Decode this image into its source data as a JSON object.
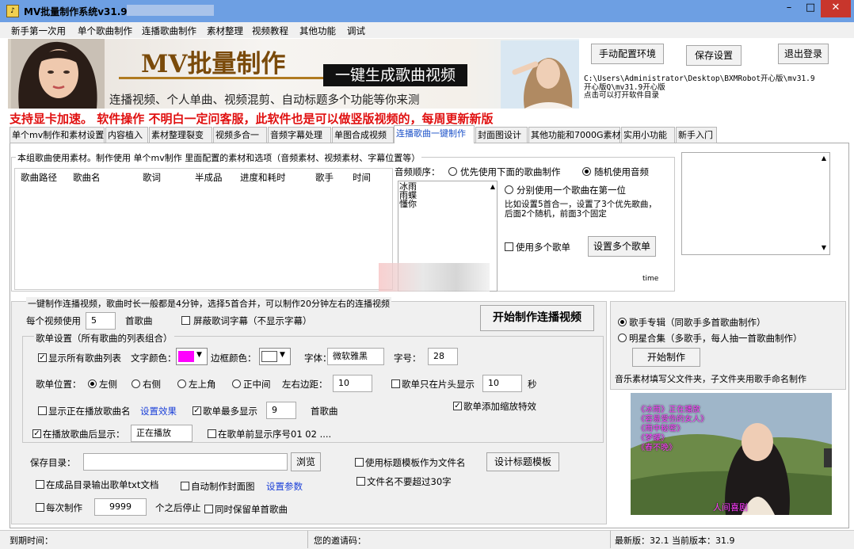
{
  "window": {
    "title": "MV批量制作系统v31.9",
    "minimize": "–",
    "maximize": "□",
    "close": "✕"
  },
  "menu": [
    "新手第一次用",
    "单个歌曲制作",
    "连播歌曲制作",
    "素材整理",
    "视频教程",
    "其他功能",
    "调试"
  ],
  "banner": {
    "big_title": "MV批量制作",
    "tagline": "一键生成歌曲视频",
    "subtitle": "连播视频、个人单曲、视频混剪、自动标题多个功能等你来测"
  },
  "top_buttons": {
    "configure": "手动配置环境",
    "save": "保存设置",
    "logout": "退出登录"
  },
  "path_info": "C:\\Users\\Administrator\\Desktop\\BXMRobot开心版\\mv31.9\n开心版Q\\mv31.9开心版\n点击可以打开软件目录",
  "notice": "支持显卡加速。 软件操作 不明白一定问客服，此软件也是可以做竖版视频的，每周更新新版",
  "tabs": [
    "单个mv制作和素材设置",
    "内容植入",
    "素材整理裂变",
    "视频多合一",
    "音频字幕处理",
    "单图合成视频",
    "连播歌曲一键制作",
    "封面图设计",
    "其他功能和7000G素材",
    "实用小功能",
    "新手入门"
  ],
  "active_tab": "连播歌曲一键制作",
  "song_group": {
    "title": "本组歌曲使用素材。制作使用 单个mv制作 里面配置的素材和选项（音频素材、视频素材、字幕位置等）",
    "columns": [
      "歌曲路径",
      "歌曲名",
      "歌词",
      "半成品",
      "进度和耗时",
      "歌手",
      "时间"
    ]
  },
  "audio_order": {
    "label": "音频顺序：",
    "opt_first": "优先使用下面的歌曲制作",
    "opt_random": "随机使用音频",
    "songs": [
      "冰雨",
      "雨蝶",
      "懂你"
    ],
    "opt_each": "分别使用一个歌曲在第一位",
    "explain": "比如设置5首合一，设置了3个优先歌曲，后面2个随机，前面3个固定",
    "multi_list": "使用多个歌单",
    "set_multi": "设置多个歌单",
    "time_label": "time"
  },
  "main": {
    "group_title": "一键制作连播视频，歌曲时长一般都是4分钟，选择5首合并，可以制作20分钟左右的连播视频",
    "per_video_label": "每个视频使用",
    "per_video_value": "5",
    "per_video_unit": "首歌曲",
    "hide_lyrics": "屏蔽歌词字幕（不显示字幕）",
    "start_button": "开始制作连播视频"
  },
  "songlist_settings": {
    "title": "歌单设置（所有歌曲的列表组合）",
    "show_all": "显示所有歌曲列表",
    "text_color_label": "文字颜色：",
    "text_color": "#ff00ff",
    "border_color_label": "边框颜色：",
    "border_color": "#ffffff",
    "font_label": "字体：",
    "font_value": "微软雅黑",
    "size_label": "字号：",
    "size_value": "28",
    "position_label": "歌单位置：",
    "pos_left": "左侧",
    "pos_right": "右侧",
    "pos_topleft": "左上角",
    "pos_center": "正中间",
    "margin_label": "左右边距：",
    "margin_value": "10",
    "only_head": "歌单只在片头显示",
    "head_seconds": "10",
    "seconds_unit": "秒",
    "show_playing_name": "显示正在播放歌曲名",
    "set_effect": "设置效果",
    "max_show": "歌单最多显示",
    "max_value": "9",
    "max_unit": "首歌曲",
    "zoom_effect": "歌单添加缩放特效",
    "after_playing": "在播放歌曲后显示：",
    "after_value": "正在播放",
    "show_index": "在歌单前显示序号01 02 ...."
  },
  "save_area": {
    "save_dir_label": "保存目录：",
    "browse": "浏览",
    "use_title_template": "使用标题模板作为文件名",
    "design_template": "设计标题模板",
    "export_txt": "在成品目录输出歌单txt文档",
    "auto_cover": "自动制作封面图",
    "set_params": "设置参数",
    "name_limit": "文件名不要超过30字",
    "every_label": "每次制作",
    "every_value": "9999",
    "every_unit": "个之后停止",
    "keep_single": "同时保留单首歌曲"
  },
  "right_panel": {
    "singer_album": "歌手专辑（同歌手多首歌曲制作）",
    "star_collection": "明星合集（多歌手，每人抽一首歌曲制作）",
    "start": "开始制作",
    "hint": "音乐素材填写父文件夹，子文件夹用歌手命名制作"
  },
  "preview": {
    "songs": [
      "《冰雨》正在播放",
      "《容易受伤的女人》",
      "《雨中秘密》",
      "《梦蝶》",
      "《春不晚》"
    ],
    "caption": "人间喜剧"
  },
  "status": {
    "expire": "到期时间：",
    "invite": "您的邀请码：",
    "version": "最新版：32.1 当前版本：31.9"
  },
  "colors": {
    "titlebar": "#6d9fe3",
    "close": "#c8362c",
    "notice": "#e01010",
    "active_tab": "#1a50c8"
  }
}
